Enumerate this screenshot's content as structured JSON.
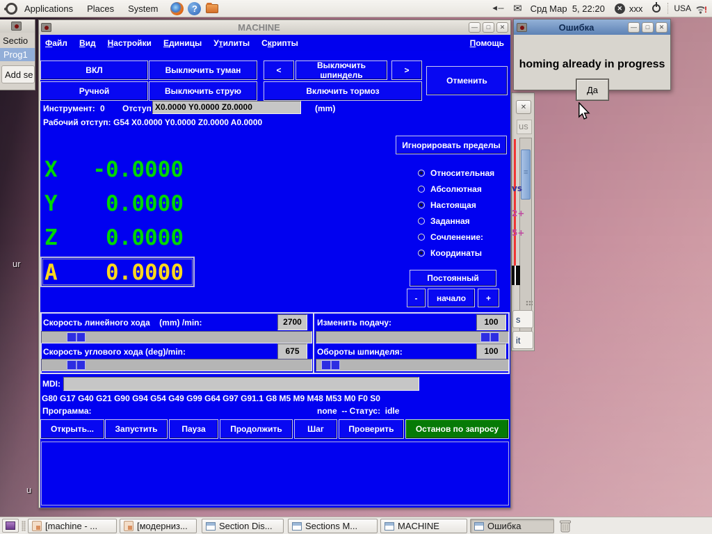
{
  "top_panel": {
    "menus": [
      "Applications",
      "Places",
      "System"
    ],
    "clock": "Срд Мар  5, 22:20",
    "user": "xxx",
    "layout": "USA",
    "wifi_alert": "!"
  },
  "machine": {
    "title": "MACHINE",
    "menus": [
      {
        "pre": "",
        "u": "Ф",
        "rest": "айл"
      },
      {
        "pre": "",
        "u": "В",
        "rest": "ид"
      },
      {
        "pre": "",
        "u": "Н",
        "rest": "астройки"
      },
      {
        "pre": "",
        "u": "Е",
        "rest": "диницы"
      },
      {
        "pre": "У",
        "u": "т",
        "rest": "илиты"
      },
      {
        "pre": "С",
        "u": "к",
        "rest": "рипты"
      }
    ],
    "help_menu": {
      "pre": "",
      "u": "П",
      "rest": "омощь"
    },
    "toolbar": {
      "power": "ВКЛ",
      "mist": "Выключить туман",
      "spindle_down": "<",
      "spindle": "Выключить шпиндель",
      "spindle_up": ">",
      "abort": "Отменить",
      "mode": "Ручной",
      "flood": "Выключить струю",
      "brake": "Включить тормоз"
    },
    "tool": {
      "label": "Инструмент:",
      "value": "0",
      "offset_label": "Отступ:",
      "offset_value": "X0.0000 Y0.0000 Z0.0000",
      "units": "(mm)"
    },
    "work_offset": {
      "label": "Рабочий отступ:",
      "value": "G54 X0.0000 Y0.0000 Z0.0000 A0.0000"
    },
    "override_limits": "Игнорировать пределы",
    "axes": [
      {
        "name": "X",
        "value": "-0.0000"
      },
      {
        "name": "Y",
        "value": "0.0000"
      },
      {
        "name": "Z",
        "value": "0.0000"
      },
      {
        "name": "A",
        "value": "0.0000"
      }
    ],
    "radios": [
      {
        "label": "Относительная",
        "selected": true
      },
      {
        "label": "Абсолютная",
        "selected": false
      },
      {
        "label": "Настоящая",
        "selected": true
      },
      {
        "label": "Заданная",
        "selected": false
      },
      {
        "label": "Сочленение:",
        "selected": false
      },
      {
        "label": "Координаты",
        "selected": true
      }
    ],
    "jog": {
      "continuous": "Постоянный",
      "minus": "-",
      "home": "начало",
      "plus": "+"
    },
    "sliders": {
      "linear": {
        "label": "Скорость линейного хода    (mm) /min:",
        "value": "2700"
      },
      "feed": {
        "label": "Изменить подачу:",
        "value": "100"
      },
      "angular": {
        "label": "Скорость углового хода (deg)/min:",
        "value": "675"
      },
      "spindle": {
        "label": "Обороты шпинделя:",
        "value": "100"
      }
    },
    "mdi_label": "MDI:",
    "active_gcodes": "G80 G17 G40 G21 G90 G94 G54 G49 G99 G64 G97 G91.1 G8 M5 M9 M48 M53 M0 F0 S0",
    "program": {
      "label": "Программа:",
      "status": "none  -- Статус:  idle"
    },
    "controls": [
      "Открыть...",
      "Запустить",
      "Пауза",
      "Продолжить",
      "Шаг",
      "Проверить"
    ],
    "stop_button": "Останов по запросу"
  },
  "dialog": {
    "title": "Ошибка",
    "message": "homing already in progress",
    "confirm": "Да"
  },
  "left_window": {
    "header": "Sectio",
    "item": "Prog1",
    "add_button": "Add se"
  },
  "hidden_window": {
    "frag_top": "us",
    "frag1": "vs",
    "frag2": "2+",
    "frag3": "5+",
    "btn1": "s",
    "btn2": "it"
  },
  "desktop": {
    "label1": "ur",
    "label2": "u"
  },
  "taskbar": {
    "items": [
      {
        "label": "[machine - ..."
      },
      {
        "label": "[модерниз..."
      },
      {
        "label": "Section Dis..."
      },
      {
        "label": "Sections M..."
      },
      {
        "label": "MACHINE"
      },
      {
        "label": "Ошибка"
      }
    ]
  }
}
